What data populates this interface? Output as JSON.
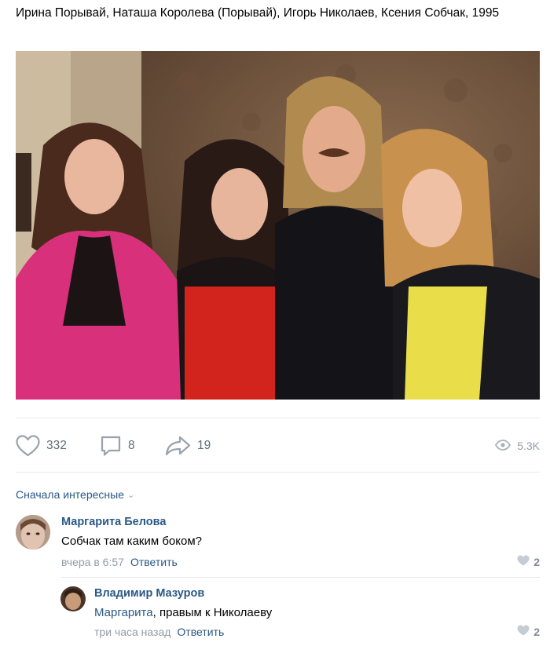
{
  "post": {
    "caption": "Ирина Порывай, Наташа Королева (Порывай), Игорь Николаев, Ксения Собчак, 1995",
    "likes": "332",
    "comments": "8",
    "shares": "19",
    "views": "5.3K"
  },
  "sort_label": "Сначала интересные",
  "comments": [
    {
      "author": "Маргарита Белова",
      "text": "Собчак там каким боком?",
      "time": "вчера в 6:57",
      "reply_label": "Ответить",
      "likes": "2"
    },
    {
      "author": "Владимир Мазуров",
      "mention": "Маргарита",
      "text": ", правым к Николаеву",
      "time": "три часа назад",
      "reply_label": "Ответить",
      "likes": "2"
    }
  ],
  "colors": {
    "link": "#2a5885",
    "meta": "#939ca6",
    "icon": "#626d7a",
    "divider": "#e7e8ec"
  },
  "icons": [
    "heart-icon",
    "comment-icon",
    "share-icon",
    "eye-icon",
    "chevron-down-icon",
    "small-heart-icon"
  ]
}
